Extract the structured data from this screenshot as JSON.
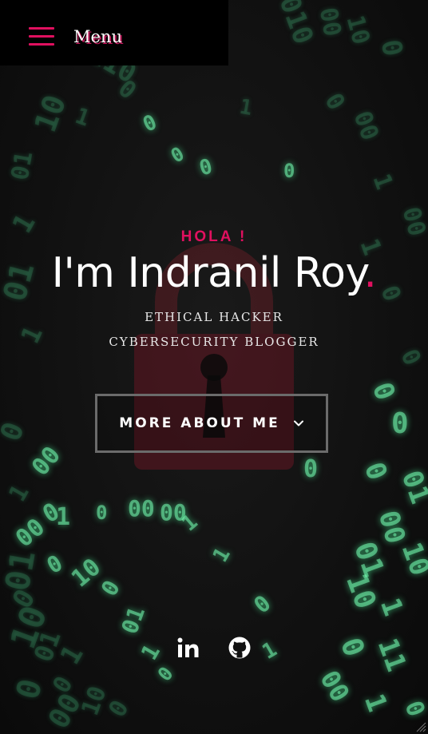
{
  "menu": {
    "label": "Menu",
    "icon": "hamburger-icon",
    "accent": "#e0105f"
  },
  "hero": {
    "greeting": "HOLA !",
    "name": "I'm Indranil Roy",
    "name_dot": ".",
    "roles": [
      "ETHICAL HACKER",
      "CYBERSECURITY BLOGGER"
    ],
    "cta": {
      "label": "MORE ABOUT ME",
      "icon": "chevron-down-icon"
    }
  },
  "socials": [
    {
      "name": "LinkedIn",
      "icon": "linkedin-icon"
    },
    {
      "name": "GitHub",
      "icon": "github-icon"
    }
  ],
  "colors": {
    "accent": "#e0105f",
    "background": "#0e0e0e",
    "text": "#ffffff",
    "button_border": "#6b6b6b",
    "binary_rain": "#5adc96",
    "lock": "#5a1820"
  }
}
